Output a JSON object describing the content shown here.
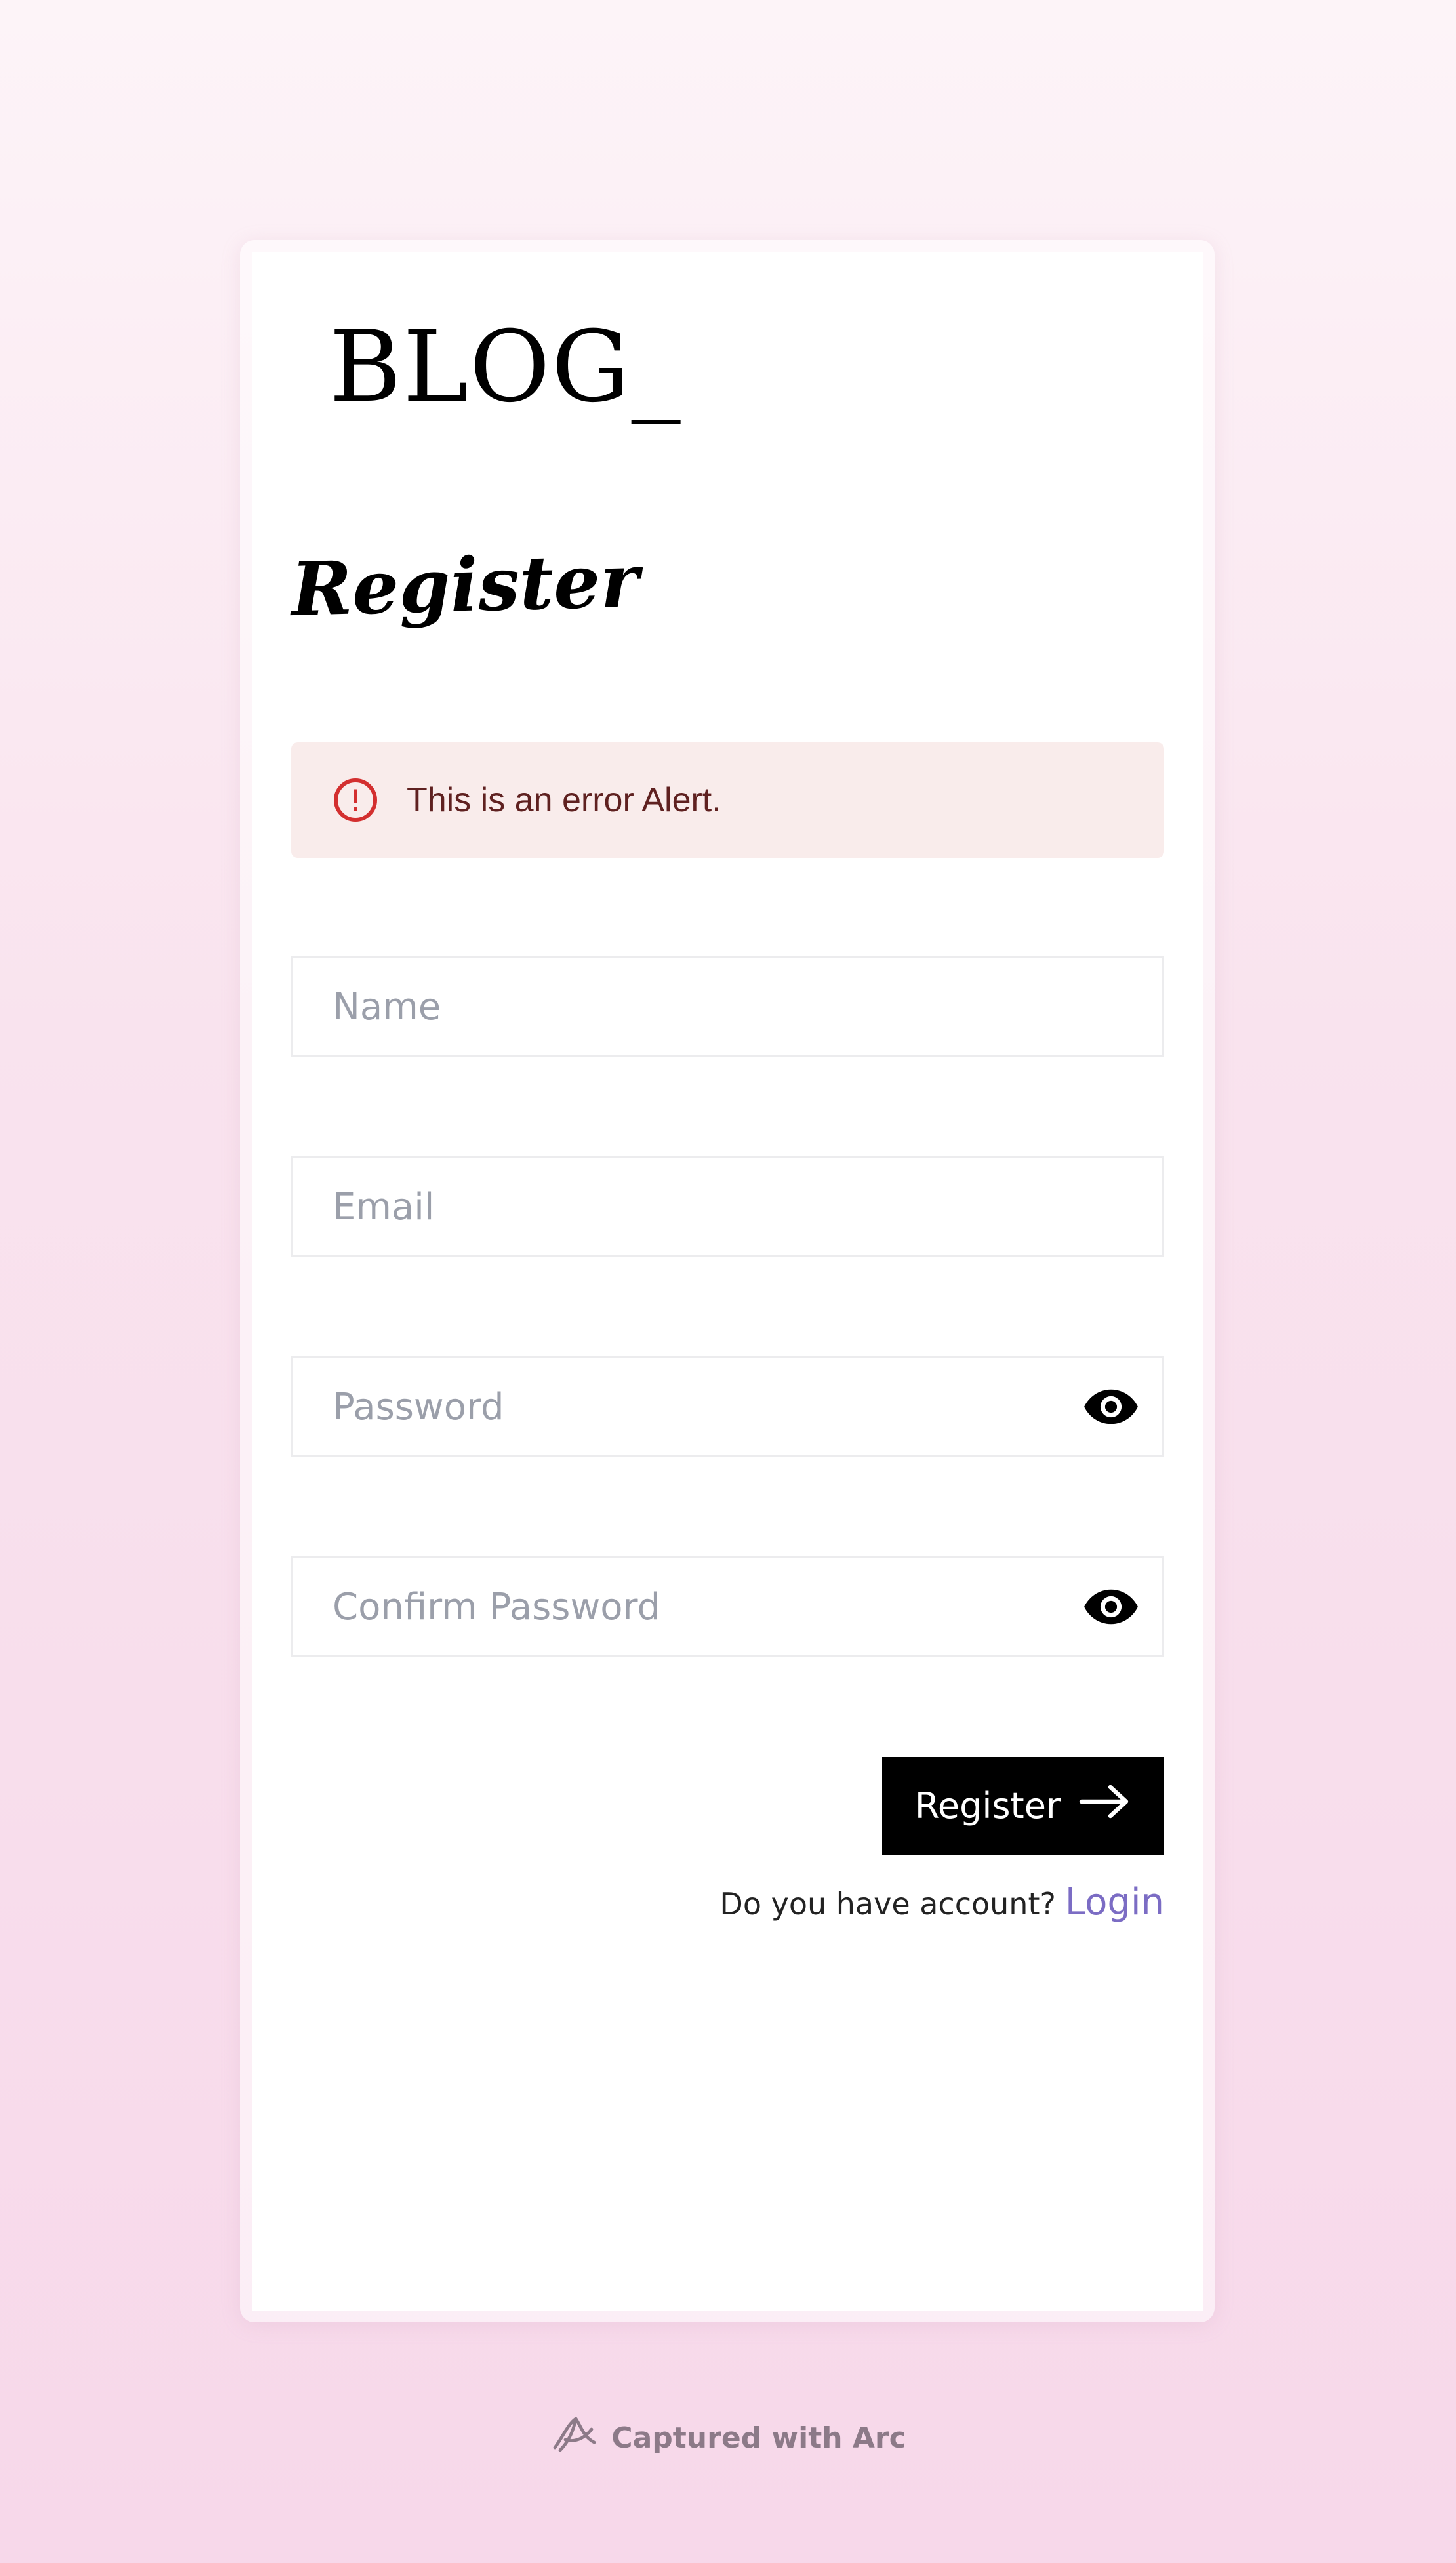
{
  "brand": {
    "logo_text": "BLOG_"
  },
  "form": {
    "title": "Register",
    "alert": {
      "severity": "error",
      "icon": "error-outline-icon",
      "message": "This is an error Alert.",
      "color": "#d32f2f"
    },
    "fields": {
      "name": {
        "placeholder": "Name",
        "value": ""
      },
      "email": {
        "placeholder": "Email",
        "value": ""
      },
      "password": {
        "placeholder": "Password",
        "value": "",
        "icon": "eye-icon"
      },
      "confirm_password": {
        "placeholder": "Confirm Password",
        "value": "",
        "icon": "eye-icon"
      }
    },
    "submit": {
      "label": "Register",
      "icon": "arrow-right-icon"
    },
    "login_prompt": {
      "text": "Do you have account?",
      "link_label": "Login"
    }
  },
  "footer": {
    "text": "Captured with Arc",
    "icon": "arc-logo-icon"
  },
  "colors": {
    "alert_bg": "#f9eceb",
    "alert_text": "#5f2120",
    "button_bg": "#000000",
    "link": "#7b6cc4",
    "placeholder": "#9b9faa"
  }
}
